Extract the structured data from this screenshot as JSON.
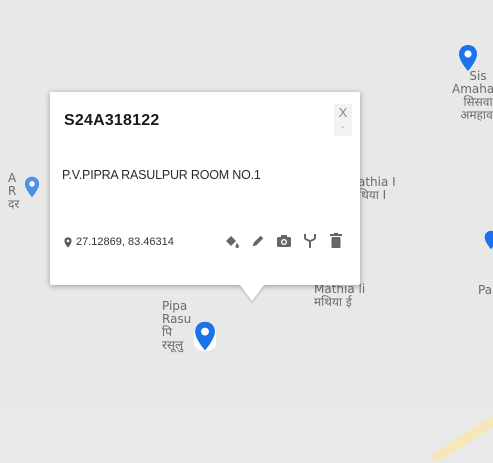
{
  "map": {
    "labels": {
      "siswa": "Sis\nAmahaw\nसिसवा\nअमहावा",
      "left_cut": "A\nR\nदर",
      "mathia_upper": "athia I\nथिया I",
      "mathia_lower": "Mathia li\nमथिया ई",
      "pipra": "Pipa\nRasu\nपि\nरसूलु",
      "right_edge": "Pa"
    },
    "colors": {
      "background": "#e8e8e8",
      "marker": "#1a73e8",
      "label": "#6b6b6b"
    }
  },
  "popup": {
    "title": "S24A318122",
    "close_label": "X",
    "address": "P.V.PIPRA RASULPUR ROOM NO.1",
    "coordinates": "27.12869, 83.46314",
    "actions": [
      {
        "name": "fill-icon"
      },
      {
        "name": "pencil-icon"
      },
      {
        "name": "camera-icon"
      },
      {
        "name": "fork-icon"
      },
      {
        "name": "trash-icon"
      }
    ]
  }
}
